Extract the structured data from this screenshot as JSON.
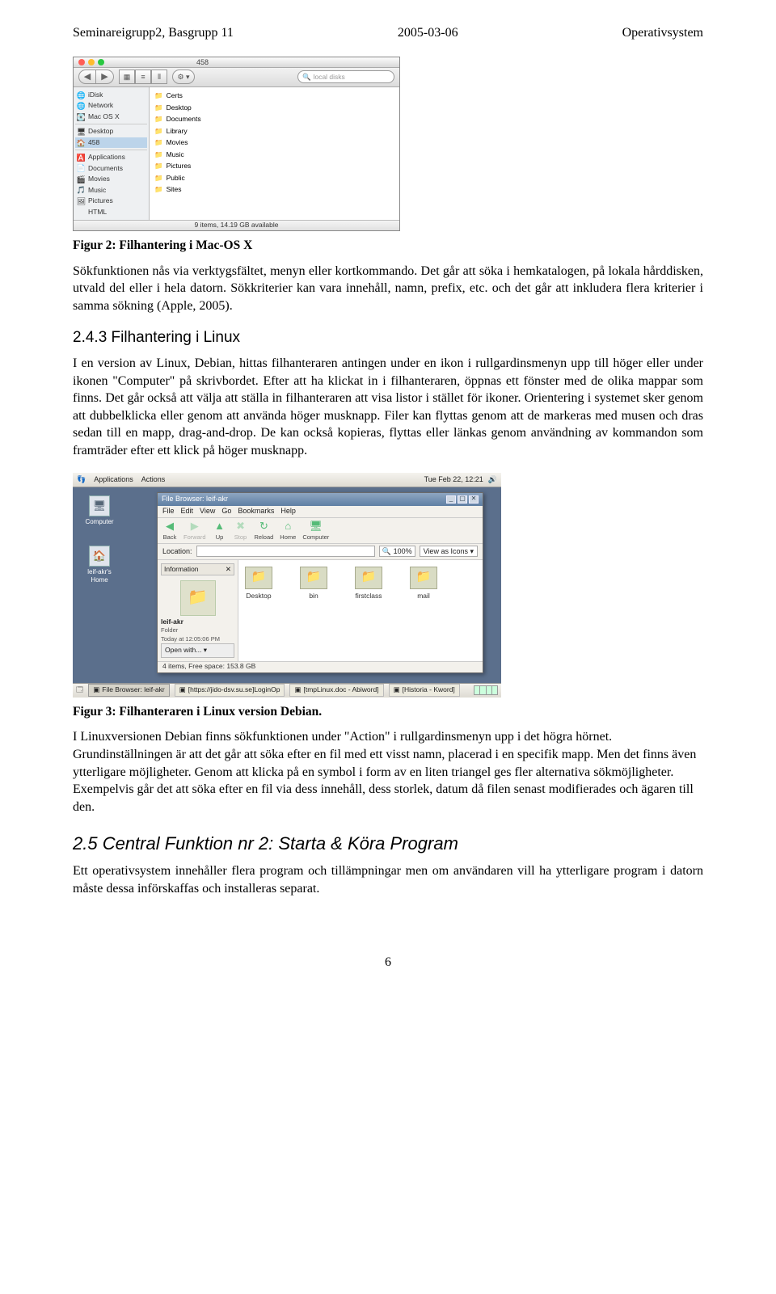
{
  "header": {
    "left": "Seminareigrupp2, Basgrupp 11",
    "center": "2005-03-06",
    "right": "Operativsystem"
  },
  "page_num": "6",
  "fig_mac": {
    "title": "458",
    "search_placeholder": "local disks",
    "tb_labels": {
      "back": "Back",
      "view": "View",
      "action": "Action",
      "search": "Search"
    },
    "sidebar": [
      "iDisk",
      "Network",
      "Mac OS X",
      "Desktop",
      "458",
      "Applications",
      "Documents",
      "Movies",
      "Music",
      "Pictures",
      "HTML"
    ],
    "sidebar_selected": 4,
    "content": [
      "Certs",
      "Desktop",
      "Documents",
      "Library",
      "Movies",
      "Music",
      "Pictures",
      "Public",
      "Sites"
    ],
    "status": "9 items, 14.19 GB available"
  },
  "text": {
    "caption1": "Figur 2: Filhantering i Mac-OS X",
    "para1": "Sökfunktionen nås via verktygsfältet, menyn eller kortkommando. Det går att söka i hemkatalogen, på lokala hårddisken, utvald del eller i hela datorn. Sökkriterier kan vara innehåll, namn, prefix, etc. och det går att inkludera flera kriterier i samma sökning (Apple, 2005).",
    "subhead1": "2.4.3   Filhantering i Linux",
    "para2": "I en version av Linux, Debian, hittas filhanteraren antingen under en ikon i rullgardinsmenyn upp till höger eller under ikonen \"Computer\" på skrivbordet. Efter att ha klickat in i filhanteraren, öppnas ett fönster med de olika mappar som finns. Det går också att välja att ställa in filhanteraren att visa listor i stället för ikoner. Orientering i systemet sker genom att dubbelklicka eller genom att använda höger musknapp. Filer kan flyttas genom att de markeras med musen och dras sedan till en mapp, drag-and-drop. De kan också kopieras, flyttas eller länkas genom användning av kommandon som framträder efter ett klick på höger musknapp.",
    "caption2": "Figur 3: Filhanteraren i Linux version Debian.",
    "para3": "I Linuxversionen Debian finns sökfunktionen under \"Action\" i rullgardinsmenyn upp i det högra hörnet. Grundinställningen är att det går att söka efter en fil med ett visst namn, placerad i en specifik mapp. Men det finns även ytterligare möjligheter. Genom att klicka på en symbol i form av en liten triangel ges fler alternativa sökmöjligheter. Exempelvis går det att söka efter en fil via dess innehåll, dess storlek, datum då filen senast modifierades och ägaren till den.",
    "secthead": "2.5  Central Funktion nr 2: Starta & Köra Program",
    "para4": "Ett operativsystem innehåller flera program och tillämpningar men om användaren vill ha ytterligare program i datorn måste dessa införskaffas och installeras separat."
  },
  "fig_lnx": {
    "panel_left": [
      "Applications",
      "Actions"
    ],
    "panel_right_time": "Tue Feb 22, 12:21",
    "desk_icons": [
      {
        "label": "Computer"
      },
      {
        "label": "leif-akr's Home"
      }
    ],
    "win": {
      "title": "File Browser: leif-akr",
      "menu": [
        "File",
        "Edit",
        "View",
        "Go",
        "Bookmarks",
        "Help"
      ],
      "tbar": [
        {
          "label": "Back",
          "icon": "◀"
        },
        {
          "label": "Forward",
          "icon": "▶",
          "disabled": true
        },
        {
          "label": "Up",
          "icon": "▲"
        },
        {
          "label": "Stop",
          "icon": "✖",
          "disabled": true
        },
        {
          "label": "Reload",
          "icon": "↻"
        },
        {
          "label": "Home",
          "icon": "⌂"
        },
        {
          "label": "Computer",
          "icon": "🖥"
        }
      ],
      "location_label": "Location:",
      "zoom": "100%",
      "view_mode": "View as Icons",
      "side": {
        "tab": "Information",
        "folder_name": "leif-akr",
        "type_line": "Folder",
        "date_line": "Today at 12:05:06 PM",
        "open_with": "Open with..."
      },
      "files": [
        "Desktop",
        "bin",
        "firstclass",
        "mail"
      ],
      "status": "4 items, Free space: 153.8 GB"
    },
    "taskbar": [
      "File Browser: leif-akr",
      "[https://jido-dsv.su.se]LoginOp",
      "[tmpLinux.doc - Abiword]",
      "[Historia - Kword]"
    ]
  }
}
